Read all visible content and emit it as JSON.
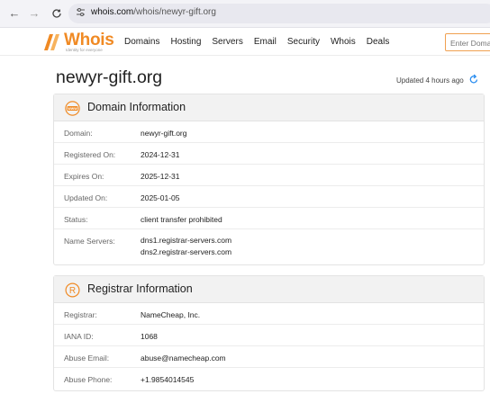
{
  "browser": {
    "url_host": "whois.com",
    "url_path": "/whois/newyr-gift.org"
  },
  "header": {
    "logo_word": "Whois",
    "logo_tagline": "Identity for everyone",
    "nav": [
      "Domains",
      "Hosting",
      "Servers",
      "Email",
      "Security",
      "Whois",
      "Deals"
    ],
    "search_placeholder": "Enter Domain"
  },
  "page": {
    "title": "newyr-gift.org",
    "updated": "Updated 4 hours ago"
  },
  "domain_info": {
    "title": "Domain Information",
    "rows": [
      {
        "label": "Domain:",
        "value": "newyr-gift.org"
      },
      {
        "label": "Registered On:",
        "value": "2024-12-31"
      },
      {
        "label": "Expires On:",
        "value": "2025-12-31"
      },
      {
        "label": "Updated On:",
        "value": "2025-01-05"
      },
      {
        "label": "Status:",
        "value": "client transfer prohibited"
      }
    ],
    "name_servers": {
      "label": "Name Servers:",
      "values": [
        "dns1.registrar-servers.com",
        "dns2.registrar-servers.com"
      ]
    }
  },
  "registrar_info": {
    "title": "Registrar Information",
    "rows": [
      {
        "label": "Registrar:",
        "value": "NameCheap, Inc."
      },
      {
        "label": "IANA ID:",
        "value": "1068"
      },
      {
        "label": "Abuse Email:",
        "value": "abuse@namecheap.com"
      },
      {
        "label": "Abuse Phone:",
        "value": "+1.9854014545"
      }
    ]
  },
  "colors": {
    "brand_orange": "#f08a24",
    "refresh_blue": "#2a8df0"
  },
  "icons": {
    "domain_card": "www-globe-icon",
    "registrar_card": "registered-icon"
  }
}
